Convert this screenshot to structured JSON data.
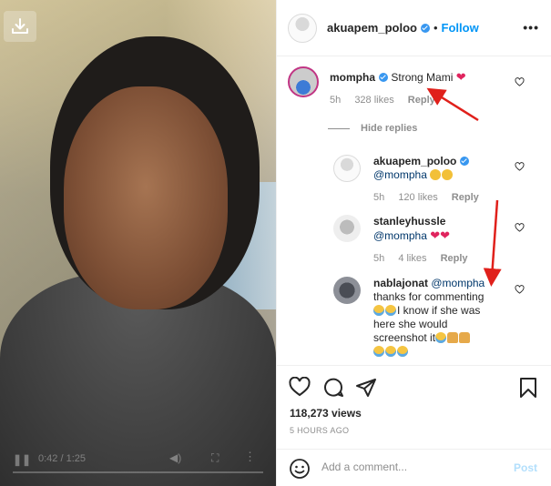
{
  "video": {
    "download_icon": "download-icon",
    "time": "0:42 / 1:25"
  },
  "post": {
    "username": "akuapem_poloo",
    "separator": "•",
    "follow_label": "Follow",
    "menu_label": "•••"
  },
  "comments": {
    "main": {
      "username": "mompha",
      "text": "Strong Mami",
      "emoji": "❤",
      "age": "5h",
      "likes": "328 likes",
      "reply": "Reply"
    },
    "hide_replies": "Hide replies",
    "replies": [
      {
        "username": "akuapem_poloo",
        "mention": "@mompha",
        "age": "5h",
        "likes": "120 likes",
        "reply": "Reply"
      },
      {
        "username": "stanleyhussle",
        "mention": "@mompha",
        "emoji": "❤❤",
        "age": "5h",
        "likes": "4 likes",
        "reply": "Reply"
      },
      {
        "username": "nablajonat",
        "mention": "@mompha",
        "line1": "thanks for commenting",
        "line2": "I know if she was",
        "line3": "here she would",
        "line4": "screenshot it"
      }
    ]
  },
  "actions": {
    "views": "118,273 views",
    "ago": "5 HOURS AGO"
  },
  "add_comment": {
    "placeholder": "Add a comment...",
    "post_label": "Post"
  },
  "colors": {
    "link": "#0095f6",
    "annotation_arrow": "#e0201b",
    "like_heart": "#ed4956"
  }
}
